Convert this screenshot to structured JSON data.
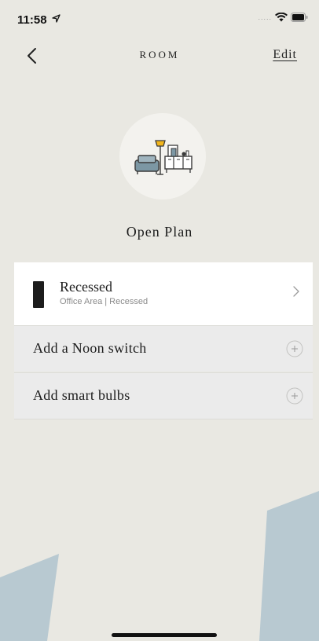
{
  "status_bar": {
    "time": "11:58",
    "signal": "....."
  },
  "nav": {
    "title": "ROOM",
    "edit_label": "Edit"
  },
  "room": {
    "name": "Open Plan",
    "icon": "living-room-icon"
  },
  "device": {
    "name": "Recessed",
    "subtitle": "Office Area | Recessed"
  },
  "actions": [
    {
      "label": "Add a Noon switch"
    },
    {
      "label": "Add smart bulbs"
    }
  ],
  "colors": {
    "background": "#e9e8e2",
    "accent_blue": "#b7c8d0",
    "text": "#1c1c1c"
  }
}
